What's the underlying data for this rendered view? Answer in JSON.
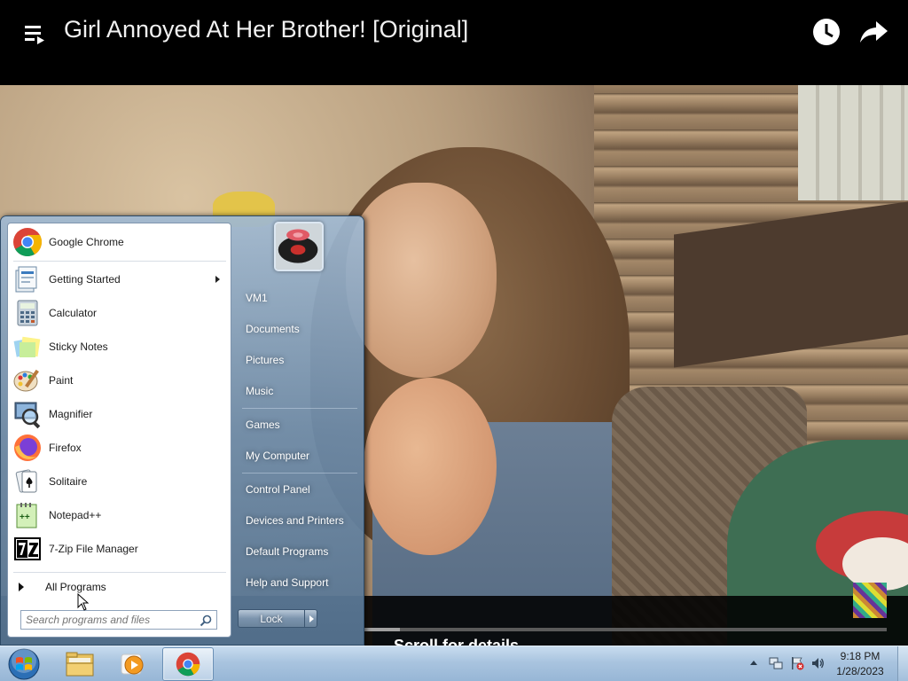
{
  "video": {
    "title": "Girl Annoyed At Her Brother! [Original]",
    "overlay_text": "Scroll for details",
    "progress": 0.07
  },
  "start_menu": {
    "programs": [
      {
        "label": "Google Chrome",
        "icon": "chrome-icon"
      },
      {
        "label": "Getting Started",
        "icon": "getting-started-icon",
        "has_submenu": true
      },
      {
        "label": "Calculator",
        "icon": "calculator-icon"
      },
      {
        "label": "Sticky Notes",
        "icon": "sticky-notes-icon"
      },
      {
        "label": "Paint",
        "icon": "paint-icon"
      },
      {
        "label": "Magnifier",
        "icon": "magnifier-icon"
      },
      {
        "label": "Firefox",
        "icon": "firefox-icon"
      },
      {
        "label": "Solitaire",
        "icon": "solitaire-icon"
      },
      {
        "label": "Notepad++",
        "icon": "notepadpp-icon"
      },
      {
        "label": "7-Zip File Manager",
        "icon": "7zip-icon"
      }
    ],
    "all_programs": "All Programs",
    "search_placeholder": "Search programs and files",
    "right_items": {
      "user": "VM1",
      "documents": "Documents",
      "pictures": "Pictures",
      "music": "Music",
      "games": "Games",
      "computer": "My Computer",
      "control_panel": "Control Panel",
      "devices": "Devices and Printers",
      "default_programs": "Default Programs",
      "help": "Help and Support"
    },
    "lock": "Lock"
  },
  "taskbar": {
    "time": "9:18 PM",
    "date": "1/28/2023",
    "pinned": [
      "windows-explorer-icon",
      "media-player-icon",
      "chrome-icon"
    ],
    "tray_icons": [
      "show-hidden-icons-arrow",
      "network-icon",
      "action-center-flag-icon",
      "volume-icon"
    ]
  }
}
